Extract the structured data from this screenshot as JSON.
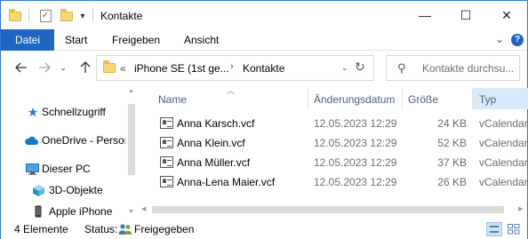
{
  "window": {
    "title": "Kontakte",
    "controls": {
      "minimize": "—",
      "maximize": "☐",
      "close": "✕"
    }
  },
  "ribbon": {
    "tabs": [
      "Datei",
      "Start",
      "Freigeben",
      "Ansicht"
    ],
    "expand_glyph": "⌄",
    "help_glyph": "?"
  },
  "address": {
    "overflow": "«",
    "segments": [
      "iPhone SE (1st ge...",
      "Kontakte"
    ],
    "separator": "›"
  },
  "search": {
    "placeholder": "Kontakte durchsu..."
  },
  "navigation": [
    {
      "label": "Schnellzugriff",
      "icon": "star-icon"
    },
    {
      "label": "OneDrive - Person",
      "icon": "cloud-icon"
    },
    {
      "label": "Dieser PC",
      "icon": "computer-icon"
    },
    {
      "label": "3D-Objekte",
      "icon": "cube-icon"
    },
    {
      "label": "Apple iPhone",
      "icon": "phone-icon"
    }
  ],
  "columns": {
    "name": "Name",
    "date": "Änderungsdatum",
    "size": "Größe",
    "type": "Typ"
  },
  "files": [
    {
      "name": "Anna Karsch.vcf",
      "date": "12.05.2023 12:29",
      "size": "24 KB",
      "type": "vCalendar"
    },
    {
      "name": "Anna Klein.vcf",
      "date": "12.05.2023 12:29",
      "size": "52 KB",
      "type": "vCalendar"
    },
    {
      "name": "Anna Müller.vcf",
      "date": "12.05.2023 12:29",
      "size": "37 KB",
      "type": "vCalendar"
    },
    {
      "name": "Anna-Lena Maier.vcf",
      "date": "12.05.2023 12:29",
      "size": "26 KB",
      "type": "vCalendar"
    }
  ],
  "status": {
    "count": "4 Elemente",
    "status_label": "Status:",
    "status_value": "Freigegeben"
  }
}
